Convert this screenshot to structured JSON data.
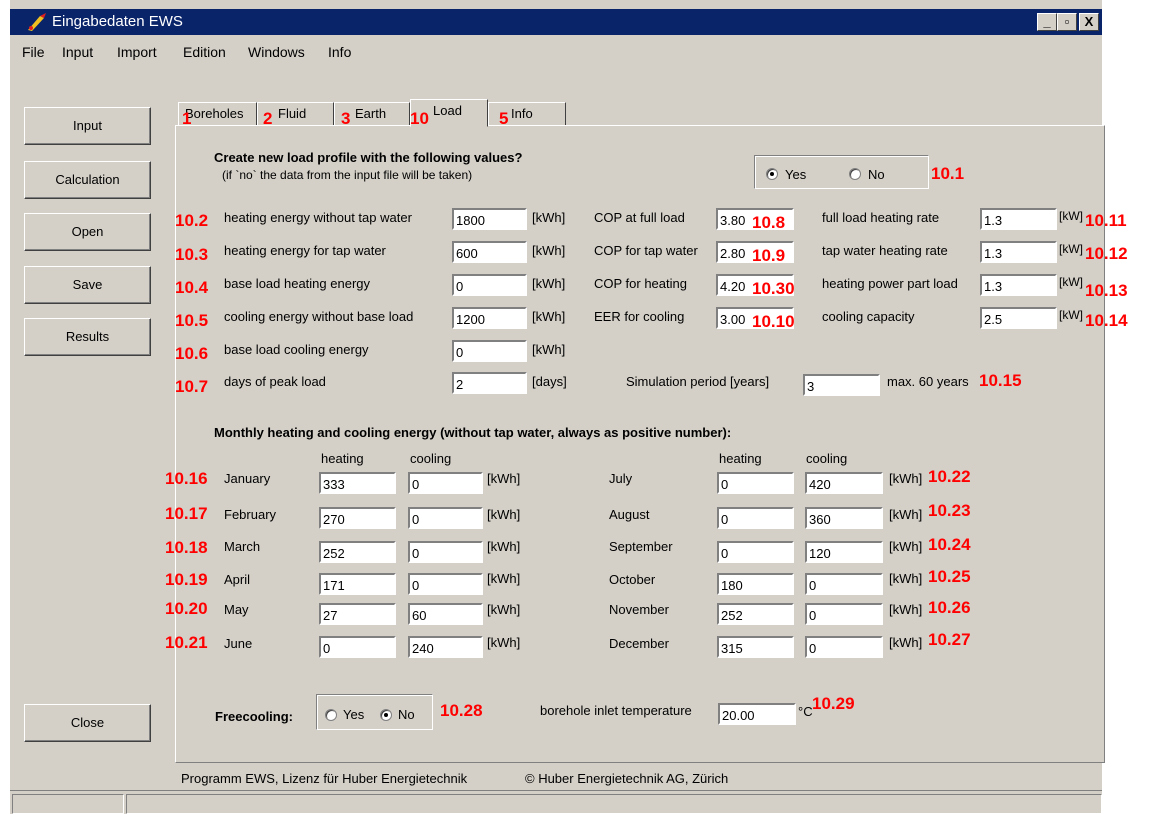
{
  "window": {
    "title": "Eingabedaten EWS",
    "minimize": "_",
    "maximize": "▫",
    "close": "X"
  },
  "menu": [
    "File",
    "Input",
    "Import",
    "Edition",
    "Windows",
    "Info"
  ],
  "sidebar": {
    "input": "Input",
    "calculation": "Calculation",
    "open": "Open",
    "save": "Save",
    "results": "Results",
    "close": "Close"
  },
  "tabs": [
    {
      "label": "Boreholes",
      "marker": "1"
    },
    {
      "label": "Fluid",
      "marker": "2"
    },
    {
      "label": "Earth",
      "marker": "3"
    },
    {
      "label": "Load",
      "marker": "10"
    },
    {
      "label": "Info",
      "marker": "5"
    }
  ],
  "load": {
    "header": "Create new load profile with the following values?",
    "subheader": "(if `no` the data from the input file will be taken)",
    "create_yes": "Yes",
    "create_no": "No",
    "create_marker": "10.1",
    "left_rows": [
      {
        "marker": "10.2",
        "label": "heating energy without tap water",
        "value": "1800",
        "unit": "[kWh]"
      },
      {
        "marker": "10.3",
        "label": "heating energy for tap water",
        "value": "600",
        "unit": "[kWh]"
      },
      {
        "marker": "10.4",
        "label": "base load heating energy",
        "value": "0",
        "unit": "[kWh]"
      },
      {
        "marker": "10.5",
        "label": "cooling energy without base load",
        "value": "1200",
        "unit": "[kWh]"
      },
      {
        "marker": "10.6",
        "label": "base load cooling energy",
        "value": "0",
        "unit": "[kWh]"
      },
      {
        "marker": "10.7",
        "label": "days of peak load",
        "value": "2",
        "unit": "[days]"
      }
    ],
    "mid_rows": [
      {
        "label": "COP at full load",
        "value": "3.80",
        "marker": "10.8"
      },
      {
        "label": "COP for tap water",
        "value": "2.80",
        "marker": "10.9"
      },
      {
        "label": "COP for heating",
        "value": "4.20",
        "marker": "10.30"
      },
      {
        "label": "EER for cooling",
        "value": "3.00",
        "marker": "10.10"
      }
    ],
    "right_rows": [
      {
        "label": "full load heating rate",
        "value": "1.3",
        "unit": "[kW]",
        "marker": "10.11"
      },
      {
        "label": "tap water heating rate",
        "value": "1.3",
        "unit": "[kW]",
        "marker": "10.12"
      },
      {
        "label": "heating power part load",
        "value": "1.3",
        "unit": "[kW]",
        "marker": "10.13"
      },
      {
        "label": "cooling capacity",
        "value": "2.5",
        "unit": "[kW]",
        "marker": "10.14"
      }
    ],
    "sim_label": "Simulation period [years]",
    "sim_value": "3",
    "sim_max": "max. 60 years",
    "sim_marker": "10.15",
    "monthly_title": "Monthly heating and cooling energy (without tap water, always as positive number):",
    "col_heating": "heating",
    "col_cooling": "cooling",
    "unit_kwh": "[kWh]",
    "months_left": [
      {
        "marker": "10.16",
        "month": "January",
        "heating": "333",
        "cooling": "0"
      },
      {
        "marker": "10.17",
        "month": "February",
        "heating": "270",
        "cooling": "0"
      },
      {
        "marker": "10.18",
        "month": "March",
        "heating": "252",
        "cooling": "0"
      },
      {
        "marker": "10.19",
        "month": "April",
        "heating": "171",
        "cooling": "0"
      },
      {
        "marker": "10.20",
        "month": "May",
        "heating": "27",
        "cooling": "60"
      },
      {
        "marker": "10.21",
        "month": "June",
        "heating": "0",
        "cooling": "240"
      }
    ],
    "months_right": [
      {
        "month": "July",
        "heating": "0",
        "cooling": "420",
        "marker": "10.22"
      },
      {
        "month": "August",
        "heating": "0",
        "cooling": "360",
        "marker": "10.23"
      },
      {
        "month": "September",
        "heating": "0",
        "cooling": "120",
        "marker": "10.24"
      },
      {
        "month": "October",
        "heating": "180",
        "cooling": "0",
        "marker": "10.25"
      },
      {
        "month": "November",
        "heating": "252",
        "cooling": "0",
        "marker": "10.26"
      },
      {
        "month": "December",
        "heating": "315",
        "cooling": "0",
        "marker": "10.27"
      }
    ],
    "freecooling_label": "Freecooling:",
    "freecooling_yes": "Yes",
    "freecooling_no": "No",
    "freecooling_marker": "10.28",
    "inlet_label": "borehole inlet temperature",
    "inlet_value": "20.00",
    "inlet_unit": "°C",
    "inlet_marker": "10.29"
  },
  "footer": {
    "license": "Programm EWS, Lizenz für Huber Energietechnik",
    "copyright": "© Huber Energietechnik AG, Zürich"
  }
}
